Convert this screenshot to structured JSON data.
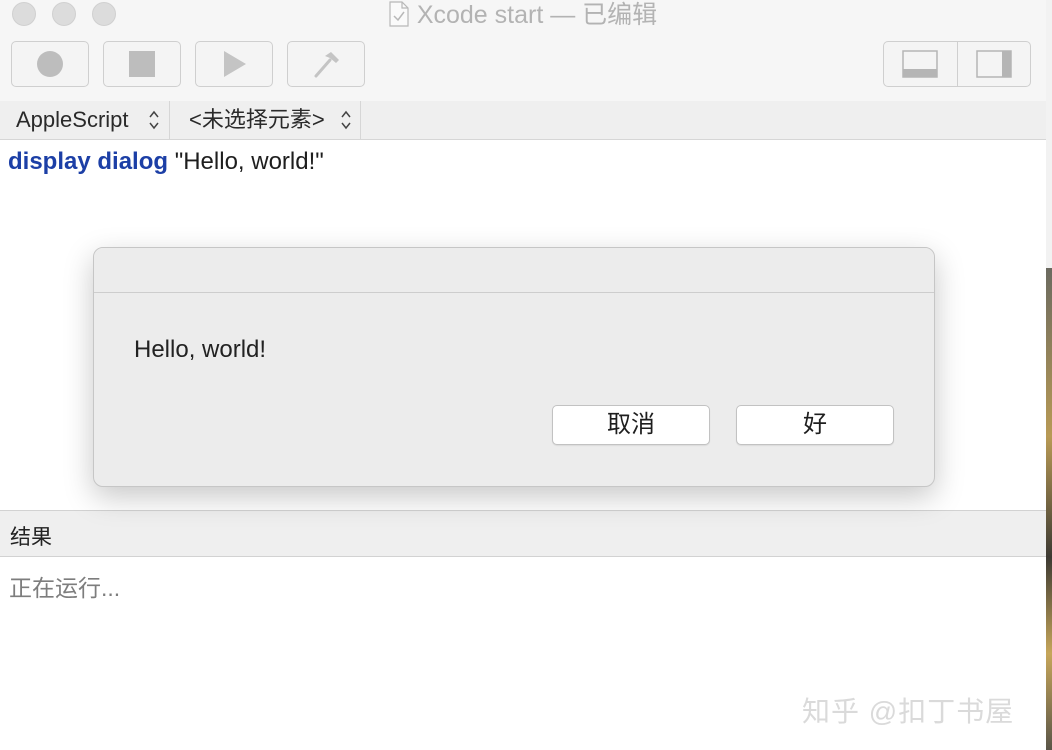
{
  "window": {
    "title": "Xcode start — 已编辑",
    "icons": {
      "close": "close-icon",
      "minimize": "minimize-icon",
      "zoom": "zoom-icon",
      "document": "document-icon"
    }
  },
  "toolbar": {
    "buttons": [
      {
        "name": "record",
        "icon": "record-icon"
      },
      {
        "name": "stop",
        "icon": "stop-icon"
      },
      {
        "name": "run",
        "icon": "play-icon"
      },
      {
        "name": "compile",
        "icon": "hammer-icon"
      }
    ],
    "view_toggles": [
      {
        "name": "bottom-panel",
        "icon": "bottom-panel-icon"
      },
      {
        "name": "side-panel",
        "icon": "side-panel-icon"
      }
    ]
  },
  "navigator": {
    "language": "AppleScript",
    "element": "<未选择元素>"
  },
  "editor": {
    "keyword": "display dialog",
    "argument": "\"Hello, world!\""
  },
  "dialog": {
    "message": "Hello, world!",
    "cancel_label": "取消",
    "ok_label": "好"
  },
  "results": {
    "header": "结果",
    "status": "正在运行..."
  },
  "watermark": "知乎 @扣丁书屋",
  "colors": {
    "keyword": "#1c3fa6",
    "window_bg": "#f6f6f6",
    "dialog_bg": "#ececec"
  }
}
